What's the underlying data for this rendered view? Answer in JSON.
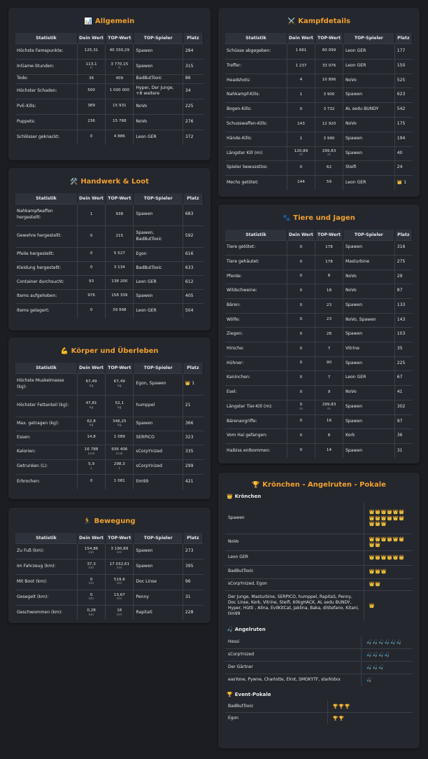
{
  "headers": [
    "Statistik",
    "Dein Wert",
    "TOP-Wert",
    "TOP-Spieler",
    "Platz"
  ],
  "icons": {
    "allgemein": "📊",
    "kampf": "⚔️",
    "handwerk": "🛠️",
    "tiere": "🐾",
    "koerper": "💪",
    "bewegung": "🏃",
    "pokale": "🏆",
    "krone": "👑",
    "angel": "🎣"
  },
  "allgemein": {
    "title": "Allgemein",
    "rows": [
      {
        "stat": "Höchste Famepunkte:",
        "val": "125,31",
        "top": "40 330,29",
        "player": "Spawen",
        "rank": "284"
      },
      {
        "stat": "InGame-Stunden:",
        "val": "113,1",
        "val_unit": "h",
        "top": "3 770,15",
        "top_unit": "h",
        "player": "Spawen",
        "rank": "315"
      },
      {
        "stat": "Tode:",
        "val": "36",
        "top": "409",
        "player": "BadButToxic",
        "rank": "86"
      },
      {
        "stat": "Höchster Schaden:",
        "val": "500",
        "top": "1 000 000",
        "player": "Hyper, Der Junge, +8 weitere",
        "rank": "34"
      },
      {
        "stat": "PvE-Kills:",
        "val": "389",
        "top": "15 931",
        "player": "NoVo",
        "rank": "225"
      },
      {
        "stat": "Puppets:",
        "val": "236",
        "top": "15 768",
        "player": "NoVo",
        "rank": "276"
      },
      {
        "stat": "Schlösser geknackt:",
        "val": "0",
        "top": "4 886",
        "player": "Leon GER",
        "rank": "372"
      }
    ]
  },
  "kampf": {
    "title": "Kampfdetails",
    "rows": [
      {
        "stat": "Schüsse abgegeben:",
        "val": "1 661",
        "top": "60 099",
        "player": "Leon GER",
        "rank": "177"
      },
      {
        "stat": "Treffer:",
        "val": "1 237",
        "top": "33 076",
        "player": "Leon GER",
        "rank": "150"
      },
      {
        "stat": "Headshots:",
        "val": "4",
        "top": "10 896",
        "player": "NoVo",
        "rank": "525"
      },
      {
        "stat": "Nahkampf-Kills:",
        "val": "1",
        "top": "3 900",
        "player": "Spawen",
        "rank": "623"
      },
      {
        "stat": "Bogen-Kills:",
        "val": "0",
        "top": "3 732",
        "player": "AL sedu BUNDY",
        "rank": "542"
      },
      {
        "stat": "Schusswaffen-Kills:",
        "val": "143",
        "top": "12 920",
        "player": "NoVo",
        "rank": "175"
      },
      {
        "stat": "Hände-Kills:",
        "val": "1",
        "top": "3 990",
        "player": "Spawen",
        "rank": "194"
      },
      {
        "stat": "Längster Kill (m):",
        "val": "120,89",
        "val_unit": "m",
        "top": "299,83",
        "top_unit": "m",
        "player": "Spawen",
        "rank": "40"
      },
      {
        "stat": "Spieler bewusstlos:",
        "val": "0",
        "top": "62",
        "player": "Steifi",
        "rank": "24"
      },
      {
        "stat": "Mechs getötet:",
        "val": "144",
        "top": "59",
        "player": "Leon GER",
        "rank": "1",
        "crown": true
      }
    ]
  },
  "handwerk": {
    "title": "Handwerk & Loot",
    "rows": [
      {
        "stat": "Nahkampfwaffen hergestellt:",
        "val": "1",
        "top": "938",
        "player": "Spawen",
        "rank": "683"
      },
      {
        "stat": "Gewehre hergestellt:",
        "val": "0",
        "top": "215",
        "player": "Spawen, BadButToxic",
        "rank": "592"
      },
      {
        "stat": "Pfeile hergestellt:",
        "val": "0",
        "top": "5 527",
        "player": "Egon",
        "rank": "616"
      },
      {
        "stat": "Kleidung hergestellt:",
        "val": "0",
        "top": "3 134",
        "player": "BadButToxic",
        "rank": "633"
      },
      {
        "stat": "Container durchsucht:",
        "val": "93",
        "top": "138 200",
        "player": "Leon GER",
        "rank": "612"
      },
      {
        "stat": "Items aufgehoben:",
        "val": "976",
        "top": "158 339",
        "player": "Spawen",
        "rank": "405"
      },
      {
        "stat": "Items gelagert:",
        "val": "0",
        "top": "39 998",
        "player": "Leon GER",
        "rank": "504"
      }
    ]
  },
  "tiere": {
    "title": "Tiere und Jagen",
    "rows": [
      {
        "stat": "Tiere getötet:",
        "val": "0",
        "top": "178",
        "player": "Spawen",
        "rank": "316"
      },
      {
        "stat": "Tiere gehäutet:",
        "val": "0",
        "top": "178",
        "player": "Masturbine",
        "rank": "275"
      },
      {
        "stat": "Pferde:",
        "val": "0",
        "top": "8",
        "player": "NoVo",
        "rank": "29"
      },
      {
        "stat": "Wildschweine:",
        "val": "0",
        "top": "18",
        "player": "NoVo",
        "rank": "87"
      },
      {
        "stat": "Bären:",
        "val": "0",
        "top": "23",
        "player": "Spawen",
        "rank": "133"
      },
      {
        "stat": "Wölfe:",
        "val": "0",
        "top": "23",
        "player": "NoVo, Spawen",
        "rank": "143"
      },
      {
        "stat": "Ziegen:",
        "val": "0",
        "top": "28",
        "player": "Spawen",
        "rank": "103"
      },
      {
        "stat": "Hirsche:",
        "val": "0",
        "top": "7",
        "player": "Vitrine",
        "rank": "35"
      },
      {
        "stat": "Hühner:",
        "val": "0",
        "top": "90",
        "player": "Spawen",
        "rank": "225"
      },
      {
        "stat": "Kaninchen:",
        "val": "0",
        "top": "7",
        "player": "Leon GER",
        "rank": "67"
      },
      {
        "stat": "Esel:",
        "val": "0",
        "top": "9",
        "player": "NoVo",
        "rank": "41"
      },
      {
        "stat": "Längster Tier-Kill (m):",
        "val": "0",
        "val_unit": "m",
        "top": "299,83",
        "top_unit": "m",
        "player": "Spawen",
        "rank": "302"
      },
      {
        "stat": "Bärenangriffe:",
        "val": "0",
        "top": "16",
        "player": "Spawen",
        "rank": "97"
      },
      {
        "stat": "Vom Hai gefangen:",
        "val": "0",
        "top": "8",
        "player": "Kork",
        "rank": "36"
      },
      {
        "stat": "Haibiss entkommen:",
        "val": "0",
        "top": "14",
        "player": "Spawen",
        "rank": "31"
      }
    ]
  },
  "koerper": {
    "title": "Körper und Überleben",
    "rows": [
      {
        "stat": "Höchste Muskelmasse (kg):",
        "val": "67,49",
        "val_unit": "kg",
        "top": "67,49",
        "top_unit": "kg",
        "player": "Egon, Spawen",
        "rank": "1",
        "crown": true
      },
      {
        "stat": "Höchster Fettanteil (kg):",
        "val": "47,81",
        "val_unit": "kg",
        "top": "52,1",
        "top_unit": "kg",
        "player": "humppel",
        "rank": "21"
      },
      {
        "stat": "Max. getragen (kg):",
        "val": "62,8",
        "val_unit": "kg",
        "top": "346,25",
        "top_unit": "kg",
        "player": "Spawen",
        "rank": "366"
      },
      {
        "stat": "Essen:",
        "val": "14,8",
        "top": "1 089",
        "player": "SERPICO",
        "rank": "323"
      },
      {
        "stat": "Kalorien:",
        "val": "16 788",
        "val_unit": "kcal",
        "top": "936 406",
        "top_unit": "kcal",
        "player": "sCorpYnized",
        "rank": "335"
      },
      {
        "stat": "Getrunken (L):",
        "val": "5,9",
        "val_unit": "L",
        "top": "298,3",
        "top_unit": "L",
        "player": "sCorpYnized",
        "rank": "299"
      },
      {
        "stat": "Erbrochen:",
        "val": "0",
        "top": "1 081",
        "player": "tim99",
        "rank": "421"
      }
    ]
  },
  "bewegung": {
    "title": "Bewegung",
    "rows": [
      {
        "stat": "Zu Fuß (km):",
        "val": "154,86",
        "val_unit": "km",
        "top": "3 190,89",
        "top_unit": "km",
        "player": "Spawen",
        "rank": "273"
      },
      {
        "stat": "Im Fahrzeug (km):",
        "val": "37,3",
        "val_unit": "km",
        "top": "17 032,61",
        "top_unit": "km",
        "player": "Spawen",
        "rank": "395"
      },
      {
        "stat": "Mit Boot (km):",
        "val": "0",
        "val_unit": "km",
        "top": "519,6",
        "top_unit": "km",
        "player": "Doc Linse",
        "rank": "96"
      },
      {
        "stat": "Gesegelt (km):",
        "val": "0",
        "val_unit": "km",
        "top": "13,67",
        "top_unit": "km",
        "player": "Penny",
        "rank": "31"
      },
      {
        "stat": "Geschwommen (km):",
        "val": "0,28",
        "val_unit": "km",
        "top": "16",
        "top_unit": "km",
        "player": "RapitaS",
        "rank": "228"
      }
    ]
  },
  "pokale": {
    "title": "Krönchen - Angelruten - Pokale",
    "kronchen": {
      "title": "Krönchen",
      "rows": [
        {
          "name": "Spawen",
          "count": 15
        },
        {
          "name": "NoVo",
          "count": 8
        },
        {
          "name": "Leon GER",
          "count": 6
        },
        {
          "name": "BadButToxic",
          "count": 3
        },
        {
          "name": "sCorpYnized, Egon",
          "count": 2
        },
        {
          "name": "Der Junge, Masturbine, SERPICO, humppel, RapitaS, Penny, Doc Linse, Kork, Vitrine, Steifi, 60kgHACK, AL sedu BUNDY, Hyper, Hütti , Alina, EvilKitCat, Jaklina, Baka, diStefano, Kitani, tim99",
          "count": 1
        }
      ]
    },
    "angelruten": {
      "title": "Angelruten",
      "rows": [
        {
          "name": "Hessi",
          "count": 6
        },
        {
          "name": "sCorpYnized",
          "count": 4
        },
        {
          "name": "Der Gärtner",
          "count": 3
        },
        {
          "name": "easYone, Pywne, Charlotte, Elrot, SMOKYTF, starkidxx",
          "count": 1
        }
      ]
    },
    "event": {
      "title": "Event-Pokale",
      "rows": [
        {
          "name": "BadButToxic",
          "count": 3
        },
        {
          "name": "Egon",
          "count": 2
        }
      ]
    }
  }
}
